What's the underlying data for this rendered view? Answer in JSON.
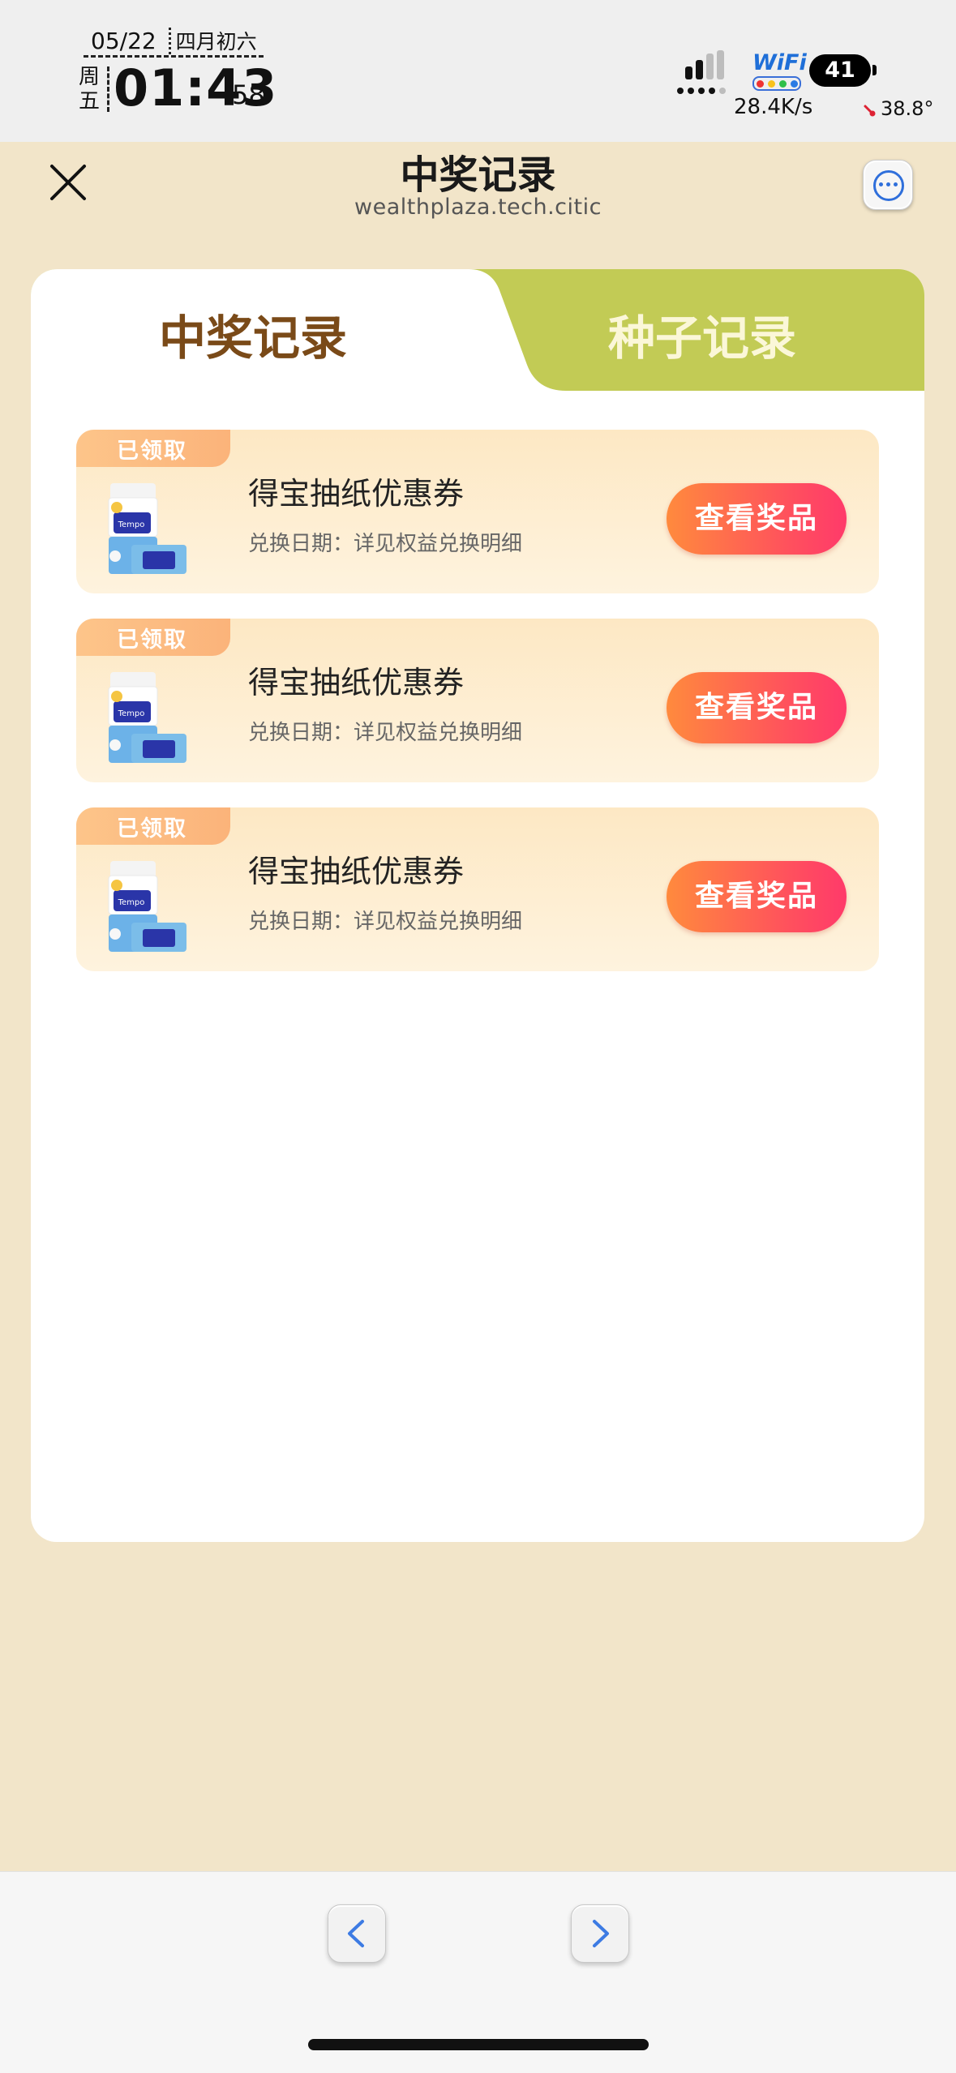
{
  "status_bar": {
    "date": "05/22",
    "lunar_date": "四月初六",
    "weekday": "周五",
    "time": "01:43",
    "seconds": "58",
    "wifi_label": "WiFi",
    "battery": "41",
    "net_speed": "28.4K/s",
    "temperature": "38.8°"
  },
  "nav": {
    "title": "中奖记录",
    "subtitle": "wealthplaza.tech.citic",
    "close_icon": "close-icon",
    "more_icon": "more-icon"
  },
  "tabs": [
    {
      "label": "中奖记录",
      "active": true
    },
    {
      "label": "种子记录",
      "active": false
    }
  ],
  "records": [
    {
      "badge": "已领取",
      "title": "得宝抽纸优惠券",
      "date": "兑换日期：详见权益兑换明细",
      "button": "查看奖品"
    },
    {
      "badge": "已领取",
      "title": "得宝抽纸优惠券",
      "date": "兑换日期：详见权益兑换明细",
      "button": "查看奖品"
    },
    {
      "badge": "已领取",
      "title": "得宝抽纸优惠券",
      "date": "兑换日期：详见权益兑换明细",
      "button": "查看奖品"
    }
  ],
  "bottom_nav": {
    "back_icon": "chevron-left-icon",
    "forward_icon": "chevron-right-icon"
  },
  "colors": {
    "page_bg": "#f2e5c9",
    "tab_inactive_bg": "#c2cb55",
    "tab_active_text": "#7a4a18",
    "button_gradient_start": "#ff8a3d",
    "button_gradient_end": "#ff3a6a"
  }
}
